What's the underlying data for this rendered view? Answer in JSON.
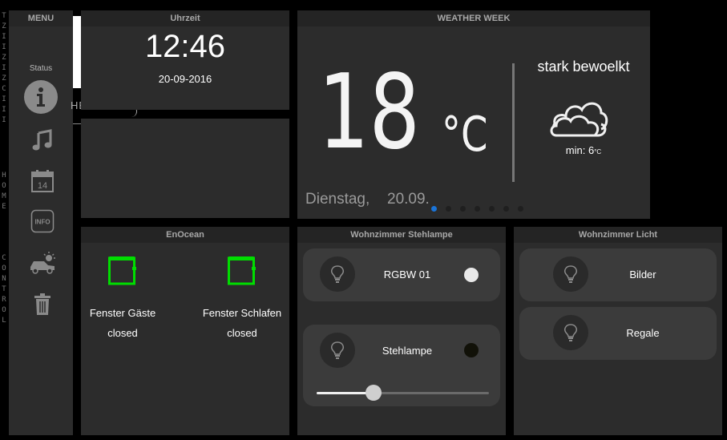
{
  "side_text": {
    "top": [
      "T",
      "Z",
      "I",
      "I",
      "Z",
      "I",
      "Z",
      "C",
      "I",
      "I",
      "I"
    ],
    "home": [
      "H",
      "O",
      "M",
      "E"
    ],
    "control": [
      "C",
      "O",
      "N",
      "T",
      "R",
      "O",
      "L"
    ]
  },
  "menu": {
    "title": "MENU",
    "status_label": "Status",
    "items": [
      {
        "icon": "info-icon"
      },
      {
        "icon": "music-note-icon"
      },
      {
        "icon": "calendar-icon",
        "badge": "14"
      },
      {
        "icon": "info-box-icon",
        "text": "INFO"
      },
      {
        "icon": "car-sun-icon"
      },
      {
        "icon": "trash-icon"
      }
    ]
  },
  "behind_text": "HEIT",
  "clock": {
    "title": "Uhrzeit",
    "time": "12:46",
    "date": "20-09-2016"
  },
  "weather": {
    "title": "WEATHER WEEK",
    "temp": "18",
    "unit": "°C",
    "condition": "stark bewoelkt",
    "min_label": "min: 6",
    "min_unit": "°C",
    "day": "Dienstag,",
    "date": "20.09.",
    "page_count": 7,
    "active_page": 0
  },
  "enocean": {
    "title": "EnOcean",
    "windows": [
      {
        "name": "Fenster Gäste",
        "state": "closed"
      },
      {
        "name": "Fenster Schlafen",
        "state": "closed"
      }
    ]
  },
  "stehlampe": {
    "title": "Wohnzimmer Stehlampe",
    "rows": [
      {
        "label": "RGBW 01",
        "state_color": "#e8e8e8"
      },
      {
        "label": "Stehlampe",
        "state_color": "#111108"
      }
    ],
    "slider_value": 0.33
  },
  "licht": {
    "title": "Wohnzimmer Licht",
    "rows": [
      {
        "label": "Bilder"
      },
      {
        "label": "Regale"
      }
    ]
  },
  "colors": {
    "accent_green": "#00dd00",
    "dot_active": "#1a74d8"
  }
}
